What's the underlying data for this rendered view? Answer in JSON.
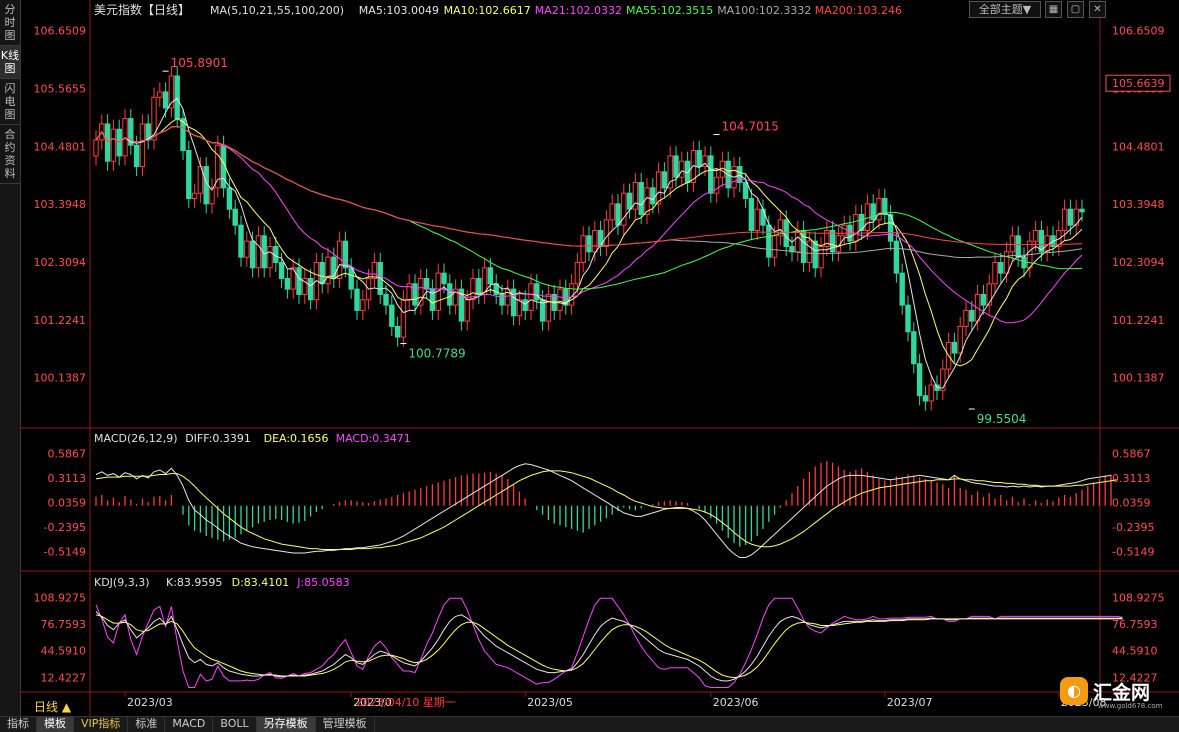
{
  "sidebar": {
    "tabs": [
      {
        "label": "分时图"
      },
      {
        "label": "K线图",
        "active": true
      },
      {
        "label": "闪电图"
      },
      {
        "label": "合约资料"
      }
    ]
  },
  "toolbar": {
    "theme_label": "全部主题▼",
    "icons": [
      "grid-icon",
      "window-icon",
      "close-icon"
    ]
  },
  "bottom_tabs": [
    {
      "label": "指标"
    },
    {
      "label": "模板",
      "active": true
    },
    {
      "label": "VIP指标",
      "vip": true
    },
    {
      "label": "标准"
    },
    {
      "label": "MACD"
    },
    {
      "label": "BOLL"
    },
    {
      "label": "另存模板",
      "active": true
    },
    {
      "label": "管理模板"
    }
  ],
  "period_label": "日线 ▲",
  "logo": {
    "mark": "◐",
    "name": "汇金网",
    "url": "www.gold678.com"
  },
  "chart_data": {
    "type": "candlestick",
    "title": "美元指数【日线】",
    "price_panel": {
      "legend": [
        {
          "text": "MA(5,10,21,55,100,200)",
          "color": "#e0e0e0"
        },
        {
          "text": "MA5:103.0049",
          "color": "#e6e6e6"
        },
        {
          "text": "MA10:102.6617",
          "color": "#ffff66"
        },
        {
          "text": "MA21:102.0332",
          "color": "#ff44ff"
        },
        {
          "text": "MA55:102.3515",
          "color": "#44ff44"
        },
        {
          "text": "MA100:102.3332",
          "color": "#aaaaaa"
        },
        {
          "text": "MA200:103.246",
          "color": "#ff4444"
        }
      ],
      "ylim": [
        99.25,
        106.85
      ],
      "y_ticks": [
        106.6509,
        105.5655,
        104.4801,
        103.3948,
        102.3094,
        101.2241,
        100.1387
      ],
      "y_tick_labels": [
        "106.6509",
        "105.5655",
        "104.4801",
        "103.3948",
        "102.3094",
        "101.2241",
        "100.1387"
      ],
      "current_price_label": "105.6639",
      "current_price": 105.6639,
      "annotations": [
        {
          "text": "105.8901",
          "value": 105.8901,
          "bar": 12,
          "color": "#ff4466"
        },
        {
          "text": "100.7789",
          "value": 100.7789,
          "bar": 53,
          "color": "#44dd88"
        },
        {
          "text": "104.7015",
          "value": 104.7015,
          "bar": 107,
          "color": "#ff4466"
        },
        {
          "text": "99.5504",
          "value": 99.5504,
          "bar": 151,
          "color": "#44dd88"
        }
      ]
    },
    "x_labels": [
      {
        "text": "2023/03",
        "bar": 5
      },
      {
        "text": "2023/0",
        "bar": 44
      },
      {
        "text": "2023/05",
        "bar": 74
      },
      {
        "text": "2023/06",
        "bar": 106
      },
      {
        "text": "2023/07",
        "bar": 136
      },
      {
        "text": "2023/08",
        "bar": 166
      }
    ],
    "crosshair_date": "2023/04/10 星期一",
    "macd_panel": {
      "legend": [
        {
          "text": "MACD(26,12,9)",
          "color": "#e0e0e0"
        },
        {
          "text": "DIFF:0.3391",
          "color": "#e6e6e6"
        },
        {
          "text": "DEA:0.1656",
          "color": "#ffff66"
        },
        {
          "text": "MACD:0.3471",
          "color": "#ff44ff"
        }
      ],
      "ylim": [
        -0.72,
        0.68
      ],
      "y_ticks": [
        0.5867,
        0.3113,
        0.0359,
        -0.2395,
        -0.5149
      ],
      "y_tick_labels": [
        "0.5867",
        "0.3113",
        "0.0359",
        "-0.2395",
        "-0.5149"
      ]
    },
    "kdj_panel": {
      "legend": [
        {
          "text": "KDJ(9,3,3)",
          "color": "#e0e0e0"
        },
        {
          "text": "K:83.9595",
          "color": "#e6e6e6"
        },
        {
          "text": "D:83.4101",
          "color": "#ffff66"
        },
        {
          "text": "J:85.0583",
          "color": "#ff44ff"
        }
      ],
      "ylim": [
        -3,
        118
      ],
      "y_ticks": [
        108.9275,
        76.7593,
        44.591,
        12.4227
      ],
      "y_tick_labels": [
        "108.9275",
        "76.7593",
        "44.5910",
        "12.4227"
      ]
    },
    "series_colors": {
      "up": "#ff3b3b",
      "down": "#2fd8a0",
      "ma5": "#e6e6e6",
      "ma10": "#ffff66",
      "ma21": "#ff44ff",
      "ma55": "#44ff44",
      "ma100": "#aaaaaa",
      "ma200": "#ff4444"
    },
    "closes": [
      104.6,
      104.9,
      104.2,
      104.8,
      104.3,
      105.0,
      104.5,
      104.1,
      104.9,
      104.6,
      105.4,
      105.5,
      105.2,
      105.8,
      105.0,
      104.4,
      103.5,
      103.6,
      104.1,
      103.4,
      103.7,
      104.5,
      103.7,
      103.3,
      103.0,
      102.4,
      102.7,
      102.2,
      102.8,
      102.2,
      102.6,
      102.3,
      102.0,
      101.8,
      102.2,
      101.7,
      102.0,
      101.6,
      102.3,
      101.9,
      102.4,
      102.0,
      102.7,
      102.2,
      101.8,
      101.4,
      101.6,
      102.0,
      102.3,
      101.7,
      101.5,
      101.1,
      100.9,
      101.6,
      101.9,
      101.5,
      102.0,
      101.8,
      101.4,
      102.1,
      101.9,
      101.5,
      101.8,
      101.2,
      101.6,
      102.0,
      101.7,
      102.2,
      101.9,
      101.7,
      101.5,
      101.8,
      101.3,
      101.6,
      101.4,
      101.9,
      101.6,
      101.2,
      101.7,
      101.4,
      101.8,
      101.5,
      101.9,
      102.3,
      102.8,
      102.5,
      102.9,
      102.6,
      103.1,
      103.4,
      103.0,
      103.6,
      103.3,
      103.8,
      103.2,
      103.7,
      103.4,
      104.0,
      103.7,
      104.3,
      103.9,
      104.2,
      103.8,
      104.4,
      104.1,
      104.3,
      103.6,
      103.9,
      104.2,
      103.7,
      104.1,
      103.8,
      103.5,
      102.9,
      103.3,
      103.0,
      102.4,
      102.8,
      103.1,
      102.6,
      102.5,
      102.9,
      102.3,
      102.7,
      102.2,
      102.6,
      102.9,
      102.5,
      102.8,
      103.0,
      102.7,
      103.2,
      102.9,
      103.4,
      103.1,
      103.5,
      103.2,
      102.7,
      102.1,
      101.5,
      101.0,
      100.4,
      99.8,
      99.7,
      100.0,
      99.9,
      100.3,
      100.8,
      100.6,
      101.1,
      101.4,
      101.2,
      101.7,
      101.5,
      101.9,
      102.3,
      102.1,
      102.5,
      102.8,
      102.4,
      102.2,
      102.7,
      102.9,
      102.5,
      102.8,
      102.6,
      102.9,
      103.3,
      103.0,
      103.3,
      103.25
    ],
    "macd_hist": [
      0.1,
      0.12,
      0.06,
      0.09,
      0.04,
      0.11,
      0.07,
      0.02,
      0.08,
      0.04,
      0.1,
      0.11,
      0.06,
      0.12,
      0.0,
      -0.1,
      -0.22,
      -0.28,
      -0.3,
      -0.34,
      -0.36,
      -0.38,
      -0.4,
      -0.38,
      -0.36,
      -0.32,
      -0.28,
      -0.24,
      -0.2,
      -0.18,
      -0.16,
      -0.15,
      -0.16,
      -0.18,
      -0.2,
      -0.19,
      -0.17,
      -0.12,
      -0.07,
      -0.04,
      0.0,
      0.02,
      0.04,
      0.06,
      0.06,
      0.05,
      0.04,
      0.03,
      0.05,
      0.07,
      0.08,
      0.1,
      0.12,
      0.14,
      0.16,
      0.18,
      0.2,
      0.22,
      0.24,
      0.26,
      0.28,
      0.3,
      0.32,
      0.34,
      0.35,
      0.36,
      0.36,
      0.37,
      0.38,
      0.36,
      0.34,
      0.3,
      0.24,
      0.16,
      0.08,
      0.0,
      -0.05,
      -0.1,
      -0.16,
      -0.2,
      -0.22,
      -0.24,
      -0.26,
      -0.28,
      -0.3,
      -0.26,
      -0.22,
      -0.18,
      -0.14,
      -0.1,
      -0.06,
      -0.02,
      -0.04,
      -0.05,
      -0.03,
      0.0,
      0.02,
      0.04,
      0.05,
      0.06,
      0.05,
      0.04,
      0.03,
      0.0,
      -0.04,
      -0.08,
      -0.14,
      -0.2,
      -0.28,
      -0.36,
      -0.42,
      -0.46,
      -0.44,
      -0.4,
      -0.34,
      -0.26,
      -0.18,
      -0.1,
      -0.02,
      0.06,
      0.14,
      0.22,
      0.3,
      0.38,
      0.44,
      0.48,
      0.5,
      0.48,
      0.44,
      0.4,
      0.38,
      0.4,
      0.42,
      0.38,
      0.34,
      0.3,
      0.28,
      0.3,
      0.33,
      0.32,
      0.35,
      0.34,
      0.32,
      0.3,
      0.28,
      0.26,
      0.24,
      0.2,
      0.34,
      0.2,
      0.18,
      0.12,
      0.16,
      0.1,
      0.14,
      0.08,
      0.12,
      0.06,
      0.1,
      0.04,
      0.08,
      0.02,
      0.06,
      0.03,
      0.07,
      0.05,
      0.09,
      0.12,
      0.1,
      0.14,
      0.18,
      0.22,
      0.26,
      0.3,
      0.34,
      0.35
    ],
    "macd_diff": [
      0.35,
      0.38,
      0.34,
      0.36,
      0.32,
      0.37,
      0.35,
      0.3,
      0.34,
      0.31,
      0.38,
      0.4,
      0.36,
      0.42,
      0.34,
      0.22,
      0.06,
      -0.05,
      -0.1,
      -0.16,
      -0.2,
      -0.25,
      -0.3,
      -0.34,
      -0.38,
      -0.42,
      -0.44,
      -0.46,
      -0.47,
      -0.48,
      -0.49,
      -0.5,
      -0.51,
      -0.52,
      -0.53,
      -0.53,
      -0.53,
      -0.52,
      -0.51,
      -0.51,
      -0.5,
      -0.5,
      -0.49,
      -0.48,
      -0.48,
      -0.47,
      -0.47,
      -0.46,
      -0.45,
      -0.44,
      -0.42,
      -0.4,
      -0.37,
      -0.34,
      -0.3,
      -0.26,
      -0.22,
      -0.18,
      -0.14,
      -0.1,
      -0.06,
      -0.02,
      0.02,
      0.06,
      0.1,
      0.14,
      0.18,
      0.22,
      0.26,
      0.3,
      0.34,
      0.38,
      0.42,
      0.45,
      0.47,
      0.46,
      0.44,
      0.42,
      0.4,
      0.37,
      0.34,
      0.31,
      0.28,
      0.24,
      0.2,
      0.16,
      0.12,
      0.08,
      0.04,
      0.0,
      -0.04,
      -0.08,
      -0.1,
      -0.12,
      -0.12,
      -0.1,
      -0.08,
      -0.06,
      -0.04,
      -0.03,
      -0.02,
      -0.02,
      -0.03,
      -0.06,
      -0.1,
      -0.16,
      -0.24,
      -0.32,
      -0.4,
      -0.48,
      -0.54,
      -0.58,
      -0.58,
      -0.55,
      -0.5,
      -0.44,
      -0.38,
      -0.32,
      -0.26,
      -0.2,
      -0.14,
      -0.08,
      -0.02,
      0.04,
      0.1,
      0.16,
      0.22,
      0.26,
      0.3,
      0.33,
      0.34,
      0.34,
      0.34,
      0.33,
      0.32,
      0.31,
      0.3,
      0.29,
      0.3,
      0.31,
      0.32,
      0.33,
      0.34,
      0.33,
      0.32,
      0.31,
      0.3,
      0.29,
      0.34,
      0.3,
      0.28,
      0.26,
      0.25,
      0.24,
      0.23,
      0.22,
      0.22,
      0.21,
      0.22,
      0.21,
      0.22,
      0.21,
      0.22,
      0.21,
      0.22,
      0.22,
      0.23,
      0.24,
      0.25,
      0.26,
      0.28,
      0.3,
      0.31,
      0.32,
      0.33,
      0.34
    ],
    "macd_dea": [
      0.3,
      0.31,
      0.32,
      0.32,
      0.32,
      0.33,
      0.33,
      0.33,
      0.33,
      0.33,
      0.34,
      0.35,
      0.35,
      0.36,
      0.36,
      0.33,
      0.28,
      0.22,
      0.15,
      0.09,
      0.03,
      -0.03,
      -0.09,
      -0.14,
      -0.19,
      -0.24,
      -0.28,
      -0.31,
      -0.34,
      -0.37,
      -0.39,
      -0.41,
      -0.43,
      -0.44,
      -0.45,
      -0.46,
      -0.47,
      -0.48,
      -0.48,
      -0.49,
      -0.49,
      -0.49,
      -0.49,
      -0.49,
      -0.49,
      -0.48,
      -0.48,
      -0.48,
      -0.47,
      -0.47,
      -0.46,
      -0.45,
      -0.44,
      -0.42,
      -0.4,
      -0.38,
      -0.36,
      -0.33,
      -0.3,
      -0.27,
      -0.24,
      -0.2,
      -0.16,
      -0.12,
      -0.08,
      -0.04,
      0.0,
      0.04,
      0.08,
      0.12,
      0.16,
      0.2,
      0.24,
      0.28,
      0.31,
      0.34,
      0.36,
      0.38,
      0.39,
      0.39,
      0.39,
      0.38,
      0.37,
      0.35,
      0.33,
      0.31,
      0.28,
      0.25,
      0.22,
      0.19,
      0.15,
      0.12,
      0.08,
      0.05,
      0.03,
      0.01,
      -0.01,
      -0.02,
      -0.03,
      -0.03,
      -0.03,
      -0.03,
      -0.03,
      -0.04,
      -0.05,
      -0.07,
      -0.1,
      -0.14,
      -0.19,
      -0.24,
      -0.3,
      -0.35,
      -0.4,
      -0.43,
      -0.45,
      -0.46,
      -0.46,
      -0.45,
      -0.43,
      -0.4,
      -0.37,
      -0.33,
      -0.29,
      -0.24,
      -0.19,
      -0.14,
      -0.09,
      -0.04,
      0.0,
      0.04,
      0.08,
      0.11,
      0.14,
      0.16,
      0.18,
      0.2,
      0.21,
      0.22,
      0.23,
      0.24,
      0.25,
      0.26,
      0.27,
      0.28,
      0.28,
      0.29,
      0.29,
      0.29,
      0.3,
      0.3,
      0.29,
      0.29,
      0.28,
      0.28,
      0.27,
      0.26,
      0.26,
      0.25,
      0.25,
      0.24,
      0.24,
      0.23,
      0.23,
      0.22,
      0.22,
      0.22,
      0.22,
      0.22,
      0.22,
      0.23,
      0.23,
      0.24,
      0.25,
      0.26,
      0.27,
      0.28,
      0.29
    ],
    "kdj_k": [
      92,
      85,
      75,
      70,
      78,
      82,
      70,
      60,
      66,
      72,
      80,
      84,
      76,
      86,
      70,
      52,
      36,
      30,
      34,
      28,
      26,
      30,
      24,
      20,
      18,
      16,
      15,
      14,
      14,
      15,
      16,
      14,
      13,
      14,
      15,
      14,
      15,
      16,
      18,
      20,
      24,
      28,
      34,
      40,
      36,
      30,
      28,
      34,
      40,
      44,
      42,
      38,
      34,
      30,
      28,
      26,
      32,
      40,
      48,
      58,
      70,
      80,
      86,
      88,
      84,
      78,
      70,
      62,
      56,
      50,
      46,
      42,
      38,
      34,
      30,
      26,
      22,
      20,
      18,
      18,
      19,
      20,
      22,
      30,
      40,
      52,
      64,
      74,
      80,
      84,
      82,
      80,
      76,
      70,
      64,
      58,
      52,
      46,
      42,
      40,
      38,
      36,
      34,
      30,
      26,
      20,
      14,
      10,
      8,
      8,
      10,
      14,
      20,
      28,
      38,
      50,
      62,
      72,
      80,
      84,
      86,
      84,
      80,
      76,
      74,
      72,
      74,
      76,
      78,
      80,
      80,
      80,
      80,
      81,
      82,
      81,
      81,
      82,
      82,
      82,
      83,
      83,
      83,
      83,
      84,
      83,
      83,
      82,
      82,
      83,
      83,
      84,
      84,
      84,
      84,
      83,
      84,
      84,
      84,
      84,
      84,
      84,
      84,
      84,
      84,
      84,
      84,
      84,
      84,
      84,
      84,
      84,
      84,
      84,
      84,
      84,
      84,
      84
    ],
    "kdj_d": [
      88,
      86,
      82,
      78,
      78,
      79,
      76,
      70,
      68,
      69,
      73,
      77,
      77,
      80,
      77,
      68,
      57,
      48,
      43,
      38,
      34,
      32,
      29,
      26,
      23,
      20,
      18,
      17,
      16,
      15,
      15,
      15,
      14,
      14,
      14,
      14,
      14,
      15,
      16,
      17,
      19,
      22,
      26,
      31,
      33,
      32,
      31,
      32,
      35,
      38,
      39,
      39,
      37,
      35,
      32,
      30,
      31,
      34,
      39,
      45,
      53,
      62,
      70,
      76,
      79,
      79,
      76,
      71,
      66,
      61,
      56,
      51,
      47,
      43,
      39,
      35,
      31,
      27,
      24,
      22,
      21,
      20,
      21,
      24,
      29,
      37,
      46,
      55,
      63,
      70,
      74,
      76,
      76,
      74,
      71,
      67,
      62,
      57,
      52,
      48,
      45,
      42,
      39,
      36,
      33,
      29,
      24,
      19,
      15,
      13,
      12,
      13,
      15,
      19,
      25,
      33,
      43,
      53,
      62,
      70,
      75,
      78,
      79,
      78,
      77,
      75,
      75,
      75,
      76,
      77,
      78,
      79,
      79,
      80,
      80,
      80,
      80,
      81,
      81,
      81,
      82,
      82,
      82,
      82,
      83,
      83,
      83,
      83,
      83,
      83,
      83,
      83,
      83,
      83,
      83,
      83,
      83,
      83,
      83,
      83,
      83,
      83,
      83,
      83,
      83,
      83,
      83,
      83,
      83,
      83,
      83,
      83,
      83,
      83,
      83,
      83,
      83,
      83
    ],
    "kdj_j": [
      100,
      83,
      61,
      54,
      78,
      88,
      58,
      40,
      62,
      78,
      94,
      98,
      74,
      98,
      56,
      20,
      0,
      0,
      16,
      8,
      10,
      26,
      14,
      8,
      8,
      8,
      9,
      8,
      10,
      15,
      18,
      12,
      11,
      14,
      17,
      14,
      17,
      18,
      22,
      26,
      34,
      40,
      50,
      58,
      42,
      26,
      22,
      38,
      50,
      56,
      48,
      36,
      28,
      20,
      20,
      18,
      34,
      52,
      66,
      84,
      100,
      108,
      108,
      108,
      94,
      76,
      58,
      44,
      36,
      28,
      26,
      24,
      20,
      16,
      12,
      8,
      4,
      6,
      6,
      10,
      15,
      20,
      24,
      42,
      62,
      82,
      100,
      108,
      108,
      108,
      98,
      88,
      76,
      62,
      50,
      40,
      32,
      24,
      22,
      24,
      24,
      24,
      24,
      18,
      12,
      2,
      0,
      0,
      0,
      0,
      6,
      16,
      30,
      46,
      64,
      84,
      100,
      108,
      108,
      108,
      108,
      96,
      82,
      72,
      68,
      66,
      72,
      78,
      82,
      86,
      84,
      82,
      82,
      83,
      86,
      83,
      83,
      84,
      84,
      84,
      85,
      85,
      85,
      85,
      86,
      83,
      83,
      80,
      80,
      83,
      83,
      86,
      86,
      86,
      86,
      83,
      86,
      86,
      86,
      86,
      86,
      86,
      86,
      86,
      86,
      86,
      86,
      86,
      86,
      86,
      86,
      86,
      86,
      86,
      86,
      86,
      86,
      85
    ]
  }
}
